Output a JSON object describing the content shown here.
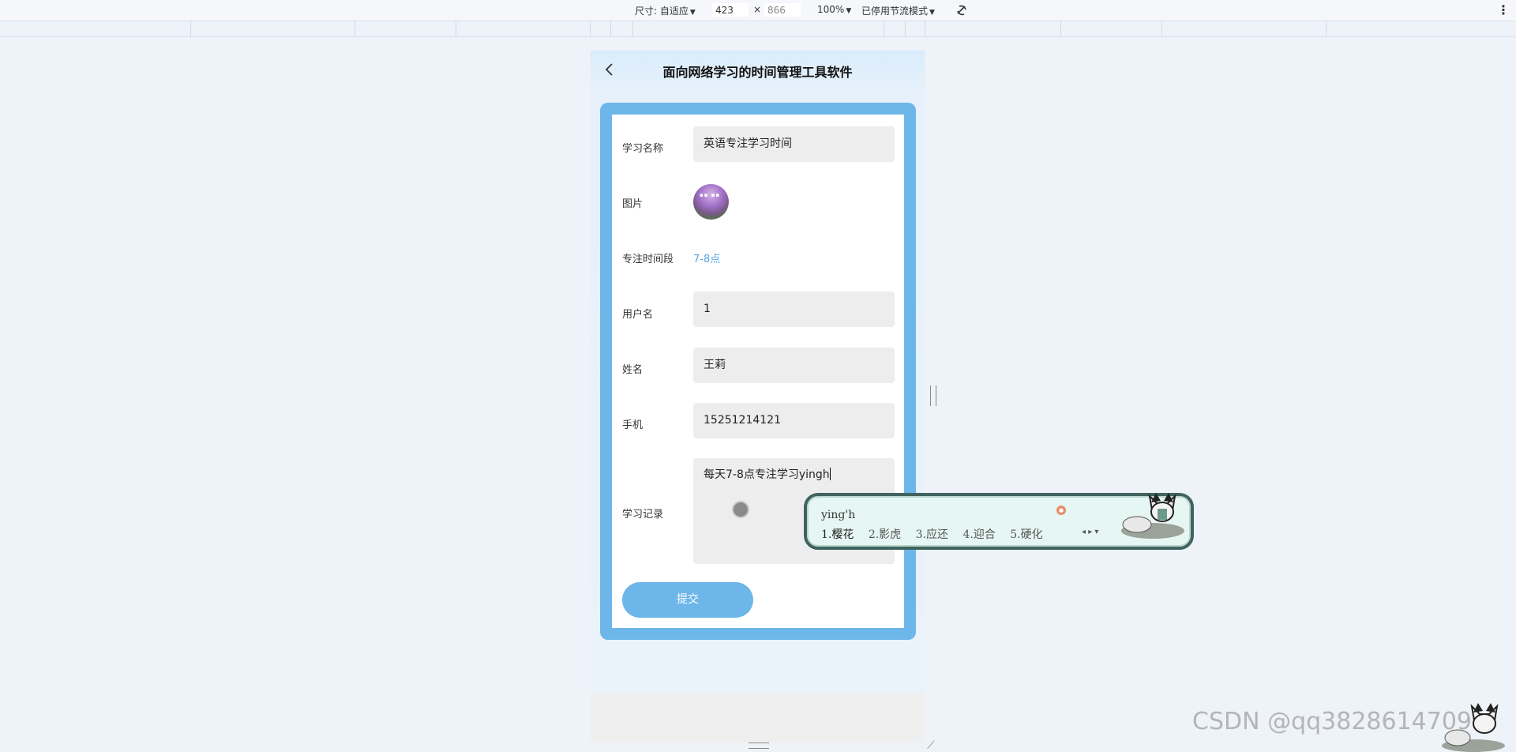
{
  "toolbar": {
    "size_label": "尺寸: 自适应",
    "width": "423",
    "times": "×",
    "height": "866",
    "zoom": "100%",
    "throttle": "已停用节流模式",
    "more_icon": "kebab-icon",
    "rotate_icon": "rotate-icon"
  },
  "app": {
    "title": "面向网络学习的时间管理工具软件",
    "back_icon": "chevron-left-icon",
    "accent": "#6db6ea"
  },
  "form": {
    "study_name": {
      "label": "学习名称",
      "value": "英语专注学习时间"
    },
    "image": {
      "label": "图片"
    },
    "time_slot": {
      "label": "专注时间段",
      "value": "7-8点"
    },
    "username": {
      "label": "用户名",
      "value": "1"
    },
    "name": {
      "label": "姓名",
      "value": "王莉"
    },
    "phone": {
      "label": "手机",
      "value": "15251214121"
    },
    "record": {
      "label": "学习记录",
      "value": "每天7-8点专注学习yingh"
    },
    "submit_label": "提交"
  },
  "ime": {
    "pinyin": "ying'h",
    "candidates": [
      "1.樱花",
      "2.影虎",
      "3.应还",
      "4.迎合",
      "5.硬化"
    ]
  },
  "watermark": "CSDN @qq3828614709"
}
